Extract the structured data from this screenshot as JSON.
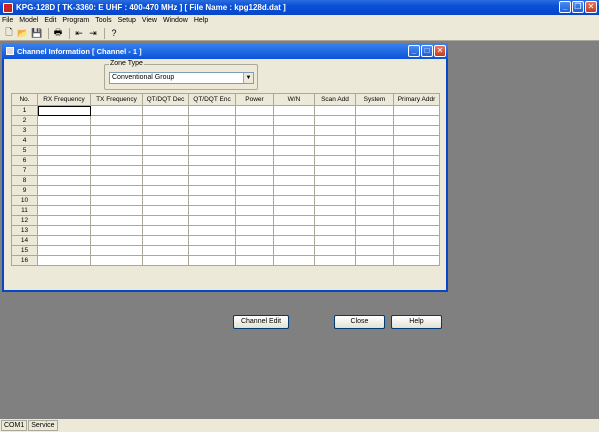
{
  "app": {
    "title": "KPG-128D  [ TK-3360: E UHF : 400-470 MHz ] [ File Name : kpg128d.dat ]"
  },
  "menu": [
    "File",
    "Model",
    "Edit",
    "Program",
    "Tools",
    "Setup",
    "View",
    "Window",
    "Help"
  ],
  "toolbar": [
    "new-file-icon",
    "open-folder-icon",
    "save-icon",
    "print-icon",
    "read-radio-icon",
    "write-radio-icon",
    "help-icon"
  ],
  "child": {
    "title": "Channel Information [ Channel - 1 ]",
    "zone_type_label": "Zone Type",
    "zone_type_value": "Conventional Group",
    "columns": [
      "No.",
      "RX Frequency",
      "TX Frequency",
      "QT/DQT Dec",
      "QT/DQT Enc",
      "Power",
      "W/N",
      "Scan Add",
      "System",
      "Primary Addr"
    ],
    "rows": [
      "1",
      "2",
      "3",
      "4",
      "5",
      "6",
      "7",
      "8",
      "9",
      "10",
      "11",
      "12",
      "13",
      "14",
      "15",
      "16"
    ],
    "buttons": {
      "channel_edit": "Channel Edit",
      "close": "Close",
      "help": "Help"
    }
  },
  "status": {
    "port": "COM1",
    "mode": "Service"
  }
}
